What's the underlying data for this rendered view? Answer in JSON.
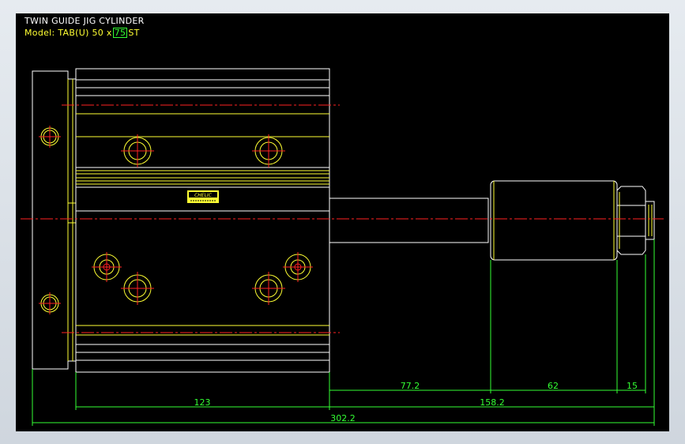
{
  "header": {
    "title": "TWIN GUIDE JIG CYLINDER",
    "model_prefix": "Model: TAB(U) 50 x",
    "model_stroke": "75",
    "model_suffix": "ST"
  },
  "logo_text": "CHELIC",
  "dimensions": {
    "body_width": "123",
    "rod_extension": "77.2",
    "rod_end": "62",
    "nut": "15",
    "stroke_total": "158.2",
    "overall": "302.2"
  },
  "colors": {
    "background": "#000000",
    "outline": "#ffffff",
    "detail": "#ffff33",
    "centerline": "#ff2222",
    "dimension": "#33ff33"
  }
}
